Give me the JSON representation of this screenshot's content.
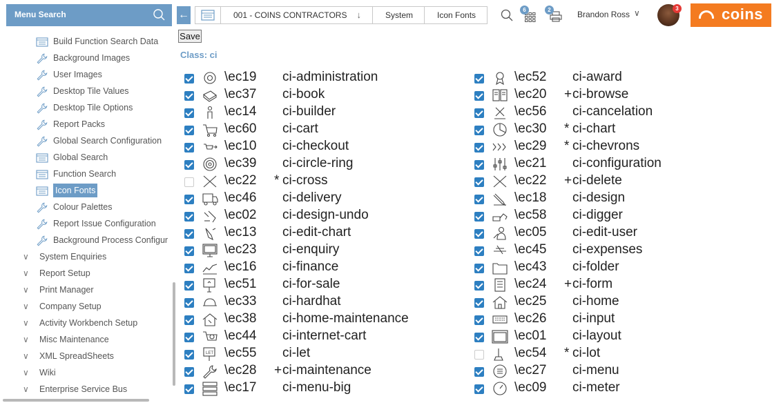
{
  "topbar": {
    "menu_search_label": "Menu Search",
    "breadcrumbs": [
      "001 - COINS CONTRACTORS",
      "System",
      "Icon Fonts"
    ],
    "apps_badge": "6",
    "print_badge": "2",
    "user_name": "Brandon Ross",
    "avatar_badge": "3",
    "logo_text": "coins",
    "accent_color": "#6d9cc6",
    "brand_color": "#f47b20"
  },
  "sidebar": {
    "items": [
      {
        "label": "Build Function Search Data",
        "icon": "table-icon",
        "type": "leaf"
      },
      {
        "label": "Background Images",
        "icon": "wrench-icon",
        "type": "leaf"
      },
      {
        "label": "User Images",
        "icon": "wrench-icon",
        "type": "leaf"
      },
      {
        "label": "Desktop Tile Values",
        "icon": "wrench-icon",
        "type": "leaf"
      },
      {
        "label": "Desktop Tile Options",
        "icon": "wrench-icon",
        "type": "leaf"
      },
      {
        "label": "Report Packs",
        "icon": "wrench-icon",
        "type": "leaf"
      },
      {
        "label": "Global Search Configuration",
        "icon": "wrench-icon",
        "type": "leaf"
      },
      {
        "label": "Global Search",
        "icon": "table-icon",
        "type": "leaf"
      },
      {
        "label": "Function Search",
        "icon": "table-icon",
        "type": "leaf"
      },
      {
        "label": "Icon Fonts",
        "icon": "table-icon",
        "type": "leaf",
        "selected": true
      },
      {
        "label": "Colour Palettes",
        "icon": "wrench-icon",
        "type": "leaf"
      },
      {
        "label": "Report Issue Configuration",
        "icon": "wrench-icon",
        "type": "leaf"
      },
      {
        "label": "Background Process Configur",
        "icon": "wrench-icon",
        "type": "leaf"
      },
      {
        "label": "System Enquiries",
        "type": "group"
      },
      {
        "label": "Report Setup",
        "type": "group"
      },
      {
        "label": "Print Manager",
        "type": "group"
      },
      {
        "label": "Company Setup",
        "type": "group"
      },
      {
        "label": "Activity Workbench Setup",
        "type": "group"
      },
      {
        "label": "Misc Maintenance",
        "type": "group"
      },
      {
        "label": "XML SpreadSheets",
        "type": "group"
      },
      {
        "label": "Wiki",
        "type": "group"
      },
      {
        "label": "Enterprise Service Bus",
        "type": "group"
      }
    ]
  },
  "main": {
    "save_label": "Save",
    "class_label": "Class: ci",
    "left_col": [
      {
        "checked": true,
        "code": "\\ec19",
        "mark": "",
        "name": "ci-administration",
        "icon": "gear-icon"
      },
      {
        "checked": true,
        "code": "\\ec37",
        "mark": "",
        "name": "ci-book",
        "icon": "book-icon"
      },
      {
        "checked": true,
        "code": "\\ec14",
        "mark": "",
        "name": "ci-builder",
        "icon": "builder-icon"
      },
      {
        "checked": true,
        "code": "\\ec60",
        "mark": "",
        "name": "ci-cart",
        "icon": "cart-icon"
      },
      {
        "checked": true,
        "code": "\\ec10",
        "mark": "",
        "name": "ci-checkout",
        "icon": "checkout-icon"
      },
      {
        "checked": true,
        "code": "\\ec39",
        "mark": "",
        "name": "ci-circle-ring",
        "icon": "circle-ring-icon"
      },
      {
        "checked": false,
        "code": "\\ec22",
        "mark": "*",
        "name": "ci-cross",
        "icon": "cross-icon"
      },
      {
        "checked": true,
        "code": "\\ec46",
        "mark": "",
        "name": "ci-delivery",
        "icon": "delivery-icon"
      },
      {
        "checked": true,
        "code": "\\ec02",
        "mark": "",
        "name": "ci-design-undo",
        "icon": "design-undo-icon"
      },
      {
        "checked": true,
        "code": "\\ec13",
        "mark": "",
        "name": "ci-edit-chart",
        "icon": "edit-chart-icon"
      },
      {
        "checked": true,
        "code": "\\ec23",
        "mark": "",
        "name": "ci-enquiry",
        "icon": "monitor-icon"
      },
      {
        "checked": true,
        "code": "\\ec16",
        "mark": "",
        "name": "ci-finance",
        "icon": "finance-icon"
      },
      {
        "checked": true,
        "code": "\\ec51",
        "mark": "",
        "name": "ci-for-sale",
        "icon": "for-sale-icon"
      },
      {
        "checked": true,
        "code": "\\ec33",
        "mark": "",
        "name": "ci-hardhat",
        "icon": "hardhat-icon"
      },
      {
        "checked": true,
        "code": "\\ec38",
        "mark": "",
        "name": "ci-home-maintenance",
        "icon": "home-maintenance-icon"
      },
      {
        "checked": true,
        "code": "\\ec44",
        "mark": "",
        "name": "ci-internet-cart",
        "icon": "internet-cart-icon"
      },
      {
        "checked": true,
        "code": "\\ec55",
        "mark": "",
        "name": "ci-let",
        "icon": "let-icon"
      },
      {
        "checked": true,
        "code": "\\ec28",
        "mark": "+",
        "name": "ci-maintenance",
        "icon": "wrench-icon"
      },
      {
        "checked": true,
        "code": "\\ec17",
        "mark": "",
        "name": "ci-menu-big",
        "icon": "menu-big-icon"
      }
    ],
    "right_col": [
      {
        "checked": true,
        "code": "\\ec52",
        "mark": "",
        "name": "ci-award",
        "icon": "award-icon"
      },
      {
        "checked": true,
        "code": "\\ec20",
        "mark": "+",
        "name": "ci-browse",
        "icon": "browse-icon"
      },
      {
        "checked": true,
        "code": "\\ec56",
        "mark": "",
        "name": "ci-cancelation",
        "icon": "cancelation-icon"
      },
      {
        "checked": true,
        "code": "\\ec30",
        "mark": "*",
        "name": "ci-chart",
        "icon": "pie-chart-icon"
      },
      {
        "checked": true,
        "code": "\\ec29",
        "mark": "*",
        "name": "ci-chevrons",
        "icon": "chevrons-icon"
      },
      {
        "checked": true,
        "code": "\\ec21",
        "mark": "",
        "name": "ci-configuration",
        "icon": "sliders-icon"
      },
      {
        "checked": true,
        "code": "\\ec22",
        "mark": "+",
        "name": "ci-delete",
        "icon": "cross-icon"
      },
      {
        "checked": true,
        "code": "\\ec18",
        "mark": "",
        "name": "ci-design",
        "icon": "design-icon"
      },
      {
        "checked": true,
        "code": "\\ec58",
        "mark": "",
        "name": "ci-digger",
        "icon": "digger-icon"
      },
      {
        "checked": true,
        "code": "\\ec05",
        "mark": "",
        "name": "ci-edit-user",
        "icon": "edit-user-icon"
      },
      {
        "checked": true,
        "code": "\\ec45",
        "mark": "",
        "name": "ci-expenses",
        "icon": "expenses-icon"
      },
      {
        "checked": true,
        "code": "\\ec43",
        "mark": "",
        "name": "ci-folder",
        "icon": "folder-icon"
      },
      {
        "checked": true,
        "code": "\\ec24",
        "mark": "+",
        "name": "ci-form",
        "icon": "form-icon"
      },
      {
        "checked": true,
        "code": "\\ec25",
        "mark": "",
        "name": "ci-home",
        "icon": "home-icon"
      },
      {
        "checked": true,
        "code": "\\ec26",
        "mark": "",
        "name": "ci-input",
        "icon": "keyboard-icon"
      },
      {
        "checked": true,
        "code": "\\ec01",
        "mark": "",
        "name": "ci-layout",
        "icon": "layout-icon"
      },
      {
        "checked": false,
        "code": "\\ec54",
        "mark": "*",
        "name": "ci-lot",
        "icon": "lot-icon"
      },
      {
        "checked": true,
        "code": "\\ec27",
        "mark": "",
        "name": "ci-menu",
        "icon": "menu-circle-icon"
      },
      {
        "checked": true,
        "code": "\\ec09",
        "mark": "",
        "name": "ci-meter",
        "icon": "meter-icon"
      }
    ]
  }
}
